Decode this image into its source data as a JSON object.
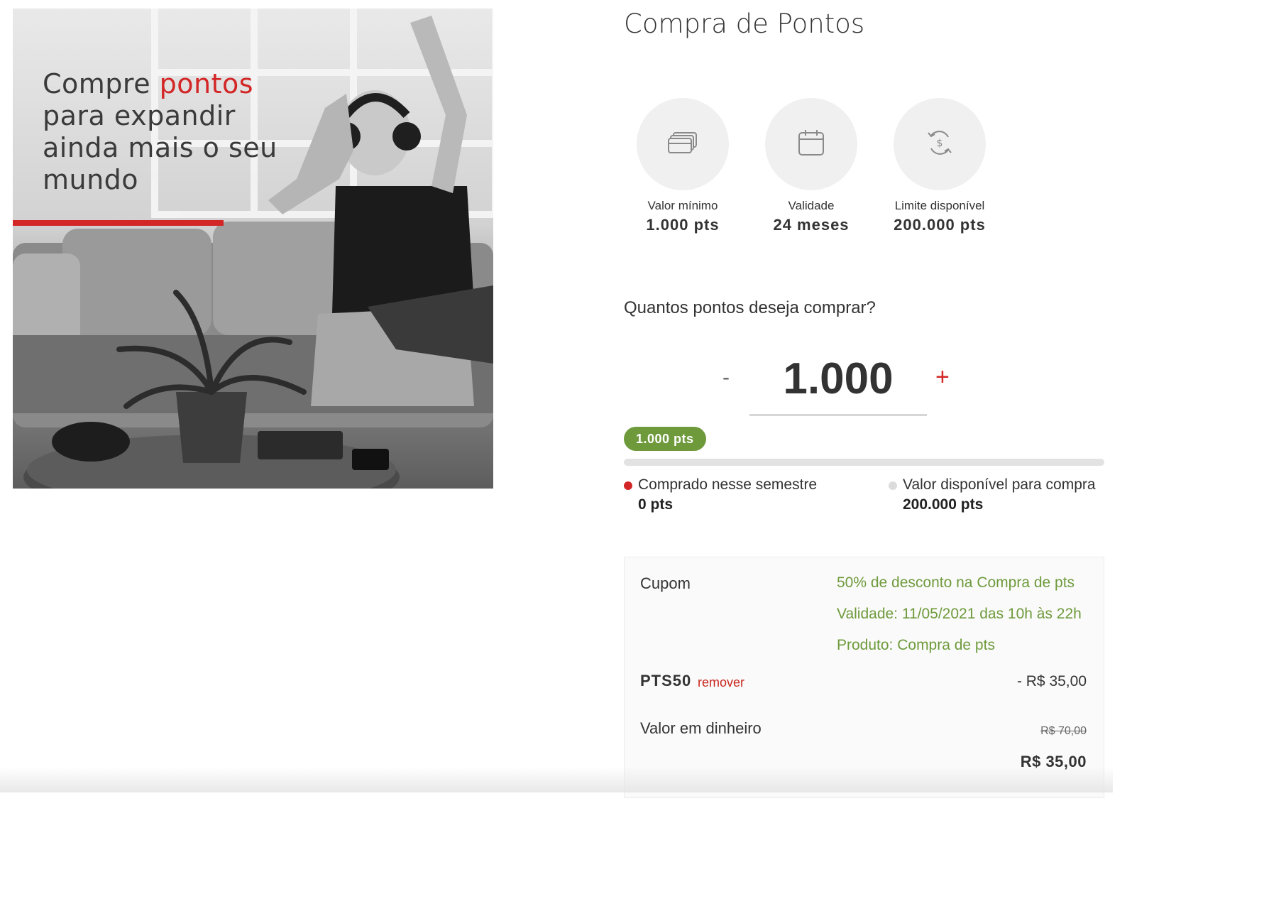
{
  "promo": {
    "headline_part1": "Compre ",
    "headline_highlight": "pontos",
    "headline_part2": "para expandir ainda mais o seu mundo"
  },
  "page": {
    "title": "Compra de Pontos"
  },
  "info_cards": [
    {
      "icon": "cards-icon",
      "label": "Valor mínimo",
      "value": "1.000 pts"
    },
    {
      "icon": "calendar-icon",
      "label": "Validade",
      "value": "24 meses"
    },
    {
      "icon": "exchange-money-icon",
      "label": "Limite disponível",
      "value": "200.000 pts"
    }
  ],
  "purchase": {
    "question": "Quantos pontos deseja comprar?",
    "minus_label": "-",
    "plus_label": "+",
    "amount": "1.000",
    "badge": "1.000 pts",
    "progress_fraction": 0
  },
  "legend": {
    "purchased_label": "Comprado nesse semestre",
    "purchased_value": "0 pts",
    "available_label": "Valor disponível para compra",
    "available_value": "200.000 pts"
  },
  "coupon": {
    "label": "Cupom",
    "details": [
      "50% de desconto na Compra de pts",
      "Validade: 11/05/2021 das 10h às 22h",
      "Produto: Compra de pts"
    ],
    "code": "PTS50",
    "remove_label": "remover",
    "discount": "- R$ 35,00"
  },
  "cash": {
    "label": "Valor em dinheiro",
    "old_price": "R$ 70,00",
    "new_price": "R$ 35,00"
  },
  "colors": {
    "accent_red": "#d32626",
    "success_green": "#6e9a3b",
    "circle_bg": "#f0f0f0"
  }
}
